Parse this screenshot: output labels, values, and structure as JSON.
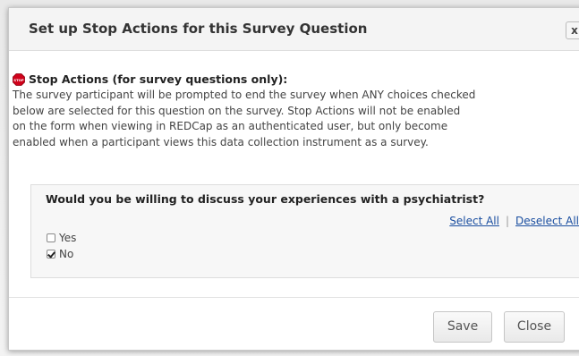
{
  "dialog": {
    "title": "Set up Stop Actions for this Survey Question",
    "close_label": "x",
    "heading": "Stop Actions (for survey questions only):",
    "description_lines": [
      "The survey participant will be prompted to end the survey when ANY choices checked",
      "below are selected for this question on the survey. Stop Actions will not be enabled",
      "on the form when viewing in REDCap as an authenticated user, but only become",
      "enabled when a participant views this data collection instrument as a survey."
    ],
    "stop_icon_text": "STOP"
  },
  "question": {
    "text": "Would you be willing to discuss your experiences with a psychiatrist?",
    "select_all": "Select All",
    "separator": "|",
    "deselect_all": "Deselect All",
    "choices": [
      {
        "label": "Yes",
        "checked": false
      },
      {
        "label": "No",
        "checked": true
      }
    ]
  },
  "footer": {
    "save_label": "Save",
    "close_label": "Close"
  },
  "colors": {
    "stop_red": "#d0021b",
    "link": "#1a4ea0"
  }
}
